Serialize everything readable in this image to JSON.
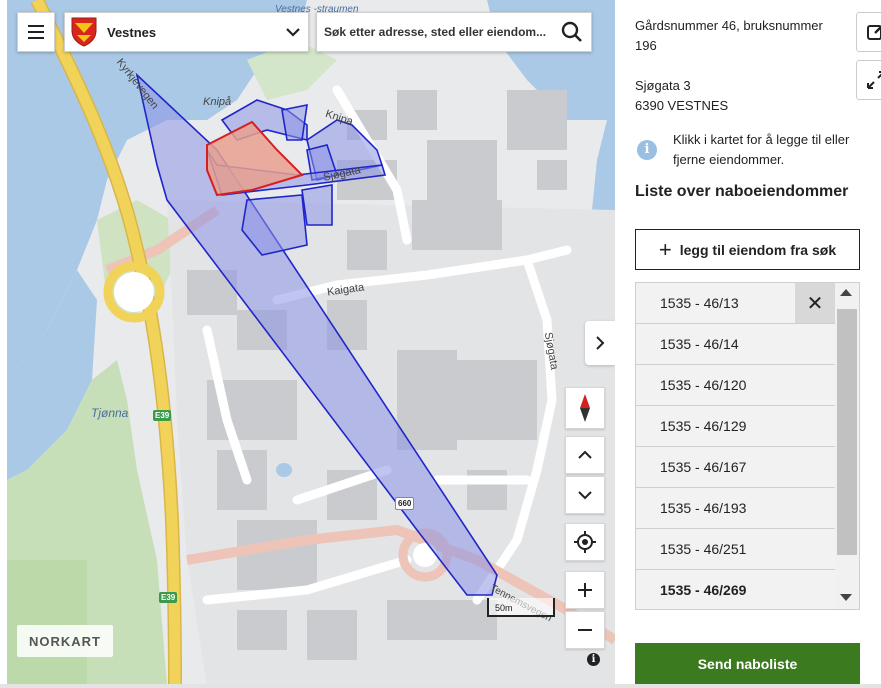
{
  "header": {
    "municipality": "Vestnes",
    "search_placeholder": "Søk etter adresse, sted eller eiendom..."
  },
  "map": {
    "labels": {
      "kirkjevegen": "Kyrkjevegen",
      "knipa_place": "Knipå",
      "knipa_street": "Knipa",
      "sjogata_upper": "Sjøgata",
      "sjogata_right": "Sjøgata",
      "kaigata": "Kaigata",
      "tjonna": "Tjønna",
      "strait": "Vestnes -straumen",
      "bottom_street": "Tennemsvegen"
    },
    "road_badges": {
      "e39_a": "E39",
      "e39_b": "E39",
      "r660": "660"
    },
    "scale_label": "50m",
    "logo_text": "NORKART",
    "attribution_icon": "i",
    "colors": {
      "water": "#aac9e6",
      "selected_fill": "#e8a08f",
      "selected_stroke": "#d62020",
      "neighbor_fill": "#8d93e6",
      "neighbor_stroke": "#1f26c9",
      "main_road": "#f2d35a"
    }
  },
  "panel": {
    "property_line1": "Gårdsnummer 46, bruksnummer",
    "property_line2": "196",
    "address_line1": "Sjøgata 3",
    "address_line2": "6390 VESTNES",
    "info_text": "Klikk i kartet for å legge til eller fjerne eiendommer.",
    "list_heading": "Liste over naboeiendommer",
    "add_button": "legg til eiendom fra søk",
    "properties": [
      "1535 - 46/13",
      "1535 - 46/14",
      "1535 - 46/120",
      "1535 - 46/129",
      "1535 - 46/167",
      "1535 - 46/193",
      "1535 - 46/251",
      "1535 - 46/269"
    ],
    "send_button": "Send naboliste",
    "accent_color": "#3b7a1e"
  }
}
